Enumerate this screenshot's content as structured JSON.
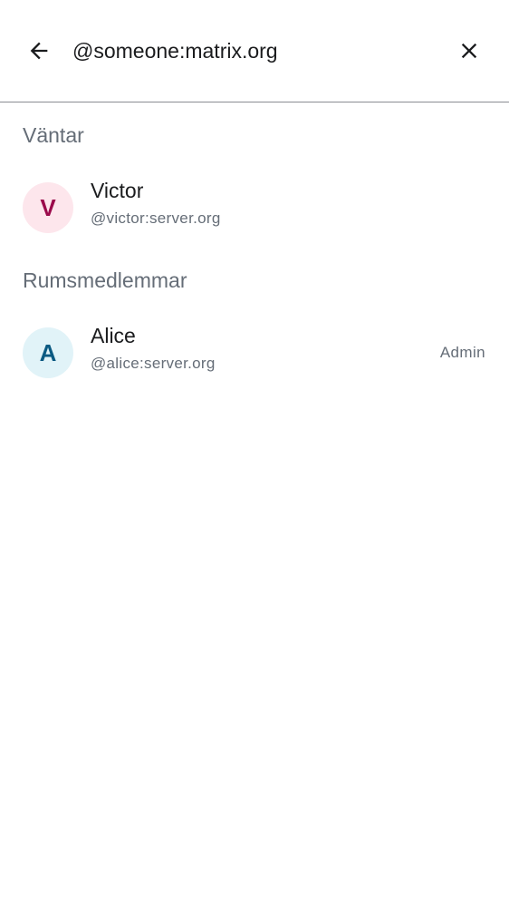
{
  "search": {
    "value": "@someone:matrix.org"
  },
  "sections": {
    "pending": {
      "title": "Väntar",
      "members": [
        {
          "initial": "V",
          "name": "Victor",
          "user_id": "@victor:server.org",
          "avatar_bg": "#fde6ec",
          "avatar_fg": "#9b0a4b"
        }
      ]
    },
    "room_members": {
      "title": "Rumsmedlemmar",
      "members": [
        {
          "initial": "A",
          "name": "Alice",
          "user_id": "@alice:server.org",
          "role": "Admin",
          "avatar_bg": "#e1f3f8",
          "avatar_fg": "#0b5a82"
        }
      ]
    }
  },
  "icons": {
    "back": "arrow-back-icon",
    "close": "close-icon"
  }
}
